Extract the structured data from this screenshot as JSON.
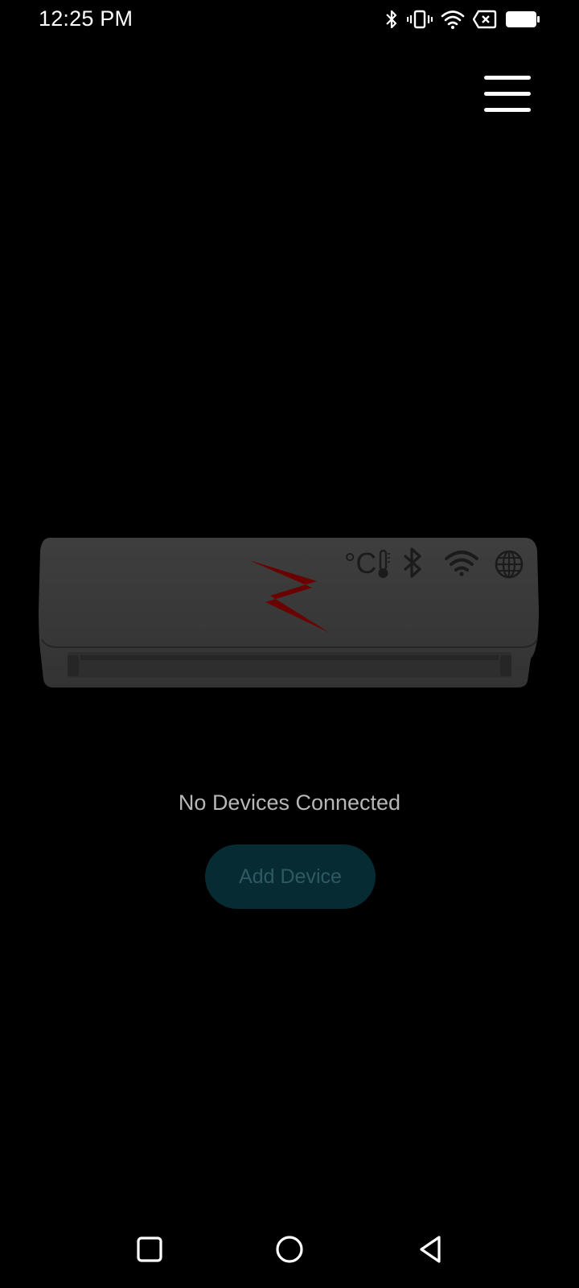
{
  "status_bar": {
    "time": "12:25 PM",
    "icons": [
      "bluetooth-icon",
      "vibrate-icon",
      "wifi-icon",
      "no-sim-icon",
      "battery-icon"
    ]
  },
  "header": {
    "menu_icon": "hamburger-menu-icon"
  },
  "device_illustration": {
    "indicator_icons": [
      "thermometer-icon",
      "bluetooth-icon",
      "wifi-icon",
      "globe-icon"
    ],
    "indicator_label": "°C",
    "logo_color": "#6b0000"
  },
  "main": {
    "empty_message": "No Devices Connected",
    "add_device_label": "Add Device"
  },
  "nav_bar": {
    "buttons": [
      "recents-square-icon",
      "home-circle-icon",
      "back-triangle-icon"
    ]
  },
  "colors": {
    "background": "#000000",
    "button_bg": "#072b33",
    "button_text": "#2f5962",
    "message_text": "#b7b7b7"
  }
}
